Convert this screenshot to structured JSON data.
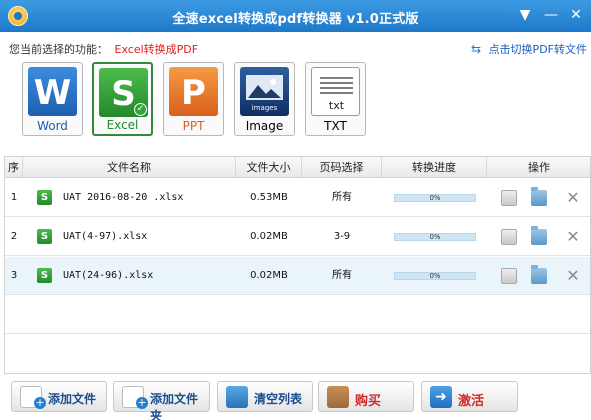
{
  "window": {
    "title": "全速excel转换成pdf转换器 v1.0正式版",
    "menu_glyph": "▼",
    "minimize_glyph": "—",
    "close_glyph": "✕"
  },
  "function_bar": {
    "label": "您当前选择的功能：",
    "current": "Excel转换成PDF",
    "switch_link": "点击切换PDF转文件"
  },
  "formats": [
    {
      "letter": "W",
      "label": "Word"
    },
    {
      "letter": "S",
      "label": "Excel",
      "selected": true
    },
    {
      "letter": "P",
      "label": "PPT"
    },
    {
      "letter": "images",
      "label": "Image"
    },
    {
      "letter": "txt",
      "label": "TXT"
    }
  ],
  "table": {
    "headers": [
      "序",
      "文件名称",
      "文件大小",
      "页码选择",
      "转换进度",
      "操作"
    ],
    "rows": [
      {
        "index": "1",
        "name": "UAT 2016-08-20 .xlsx",
        "size": "0.53MB",
        "pages": "所有",
        "progress": "0%",
        "progress_value": 0
      },
      {
        "index": "2",
        "name": "UAT(4-97).xlsx",
        "size": "0.02MB",
        "pages": "3-9",
        "progress": "0%",
        "progress_value": 0
      },
      {
        "index": "3",
        "name": "UAT(24-96).xlsx",
        "size": "0.02MB",
        "pages": "所有",
        "progress": "0%",
        "progress_value": 0,
        "selected": true
      }
    ]
  },
  "bottom_buttons": {
    "add_file": "添加文件",
    "add_folder": "添加文件夹",
    "clear_list": "清空列表",
    "buy": "购买",
    "activate": "激活"
  },
  "icons": {
    "add_plus": "+",
    "activate_arrow": "➜"
  },
  "colors": {
    "titlebar": "#1e78c8",
    "accent_red": "#e02020",
    "link_blue": "#1b5fbf",
    "selected_row": "#eaf4fb"
  }
}
